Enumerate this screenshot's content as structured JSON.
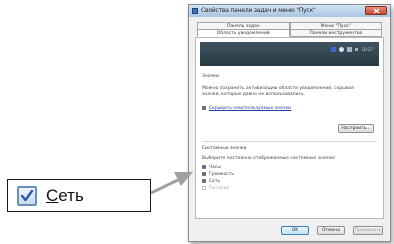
{
  "dialog": {
    "title": "Свойства панели задач и меню \"Пуск\"",
    "tabs_row1": [
      "Панель задач",
      "Меню \"Пуск\""
    ],
    "tabs_row2": [
      "Область уведомлений",
      "Панели инструментов"
    ],
    "clock_time": "10:27",
    "icons_section": "Значки",
    "icons_desc_line1": "Можно сохранить активизацию области уведомлений, скрывая",
    "icons_desc_line2": "значки, которые давно не использовались.",
    "hide_inactive_label": "Скрывать неиспользуемые значки",
    "customize_button": "Настроить...",
    "system_section": "Системные значки",
    "system_desc": "Выберите постоянно отображаемые системные значки:",
    "system_items": [
      "Часы",
      "Громкость",
      "Сеть",
      "Питание"
    ],
    "ok_button": "OK",
    "cancel_button": "Отмена",
    "apply_button": "Применить"
  },
  "zoom": {
    "checkbox_label_first": "С",
    "checkbox_label_rest": "еть"
  }
}
